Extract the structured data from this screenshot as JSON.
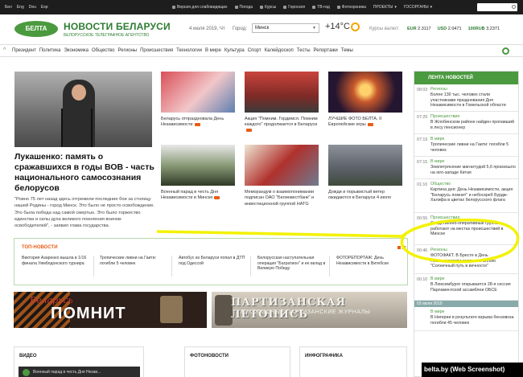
{
  "topbar": {
    "langs": [
      "Бел",
      "Eng",
      "Deu",
      "Esp"
    ],
    "links": [
      "Версия для слабовидящих",
      "Погода",
      "Курсы",
      "Гороскоп",
      "ТВ-гид",
      "Фотохроника",
      "ПРОЕКТЫ",
      "ГОСОРГАНЫ"
    ]
  },
  "header": {
    "logo": "БЕЛТА",
    "title": "НОВОСТИ БЕЛАРУСИ",
    "subtitle": "БЕЛОРУССКОЕ ТЕЛЕГРАФНОЕ АГЕНТСТВО",
    "date": "4 июля 2019, Чт",
    "city_label": "Город:",
    "city": "Минск",
    "temperature": "+14°C",
    "rates_label": "Курсы валют:",
    "rates": [
      {
        "code": "EUR",
        "value": "2.3117"
      },
      {
        "code": "USD",
        "value": "2.0471"
      },
      {
        "code": "100RUB",
        "value": "3.2371"
      }
    ]
  },
  "nav": {
    "items": [
      "Президент",
      "Политика",
      "Экономика",
      "Общество",
      "Регионы",
      "Происшествия",
      "Технологии",
      "В мире",
      "Культура",
      "Спорт",
      "Калейдоскоп",
      "Тесты",
      "Репортажи",
      "Темы"
    ]
  },
  "lead": {
    "title": "Лукашенко: память о сражавшихся в годы ВОВ - часть национального самосознания белорусов",
    "text": "\"Ровно 75 лет назад здесь отгремели последние бои за столицу нашей Родины - город Минск. Это было не просто освобождение. Это была победа над самой смертью. Это было торжество единства и силы духа великого поколения воинов-освободителей\", - заявил глава государства."
  },
  "thumbs": [
    {
      "caption": "Беларусь отпраздновала День Независимости"
    },
    {
      "caption": "Акция \"Помним. Гордимся. Помним каждого\" продолжается в Беларуси"
    },
    {
      "caption": "ЛУЧШИЕ ФОТО БЕЛТА. II Европейские игры"
    },
    {
      "caption": "Военный парад в честь Дня Независимости в Минске"
    },
    {
      "caption": "Меморандум о взаимопонимании подписан ОАО \"Белинвестбанк\" и инвестиционной группой HATG"
    },
    {
      "caption": "Дожди и порывистый ветер ожидаются в Беларуси 4 июля"
    }
  ],
  "feed": {
    "title": "ЛЕНТА НОВОСТЕЙ",
    "items": [
      {
        "time": "08:03",
        "cat": "Регионы",
        "text": "Более 130 тыс. человек стали участниками празднования Дня Независимости в Гомельской области"
      },
      {
        "time": "07:29",
        "cat": "Происшествия",
        "text": "В Жлобинском районе найден пропавший в лесу пенсионер"
      },
      {
        "time": "07:19",
        "cat": "В мире",
        "text": "Тропические ливни на Гаити: погибли 5 человек"
      },
      {
        "time": "07:15",
        "cat": "В мире",
        "text": "Землетрясение магнитудой 5,6 произошло на юго-западе Китая"
      },
      {
        "time": "01:10",
        "cat": "Общество",
        "text": "Картина дня: День Независимости, акция \"Беларусь помнит\" и небоскреб Бурдж-Халифа в цветах белорусского флага"
      },
      {
        "time": "00:55",
        "cat": "Происшествия",
        "text": "Следственно-оперативные группы работают на местах происшествий в Минске"
      },
      {
        "time": "00:46",
        "cat": "Регионы",
        "text": "ФОТОФАКТ. В Бресте в День Независимости заложили аллею \"Солнечный путь в вечности\""
      },
      {
        "time": "00:10",
        "cat": "В мире",
        "text": "В Люксембурге открывается 28-я сессия Парламентской ассамблеи ОБСЕ"
      },
      {
        "time": "",
        "cat": "В мире",
        "text": "В Нигерии в результате взрыва бензовоза погибли 45 человек"
      }
    ],
    "date_separator": "03 июля 2019"
  },
  "top_news": {
    "title": "ТОП-НОВОСТИ",
    "items": [
      "Виктория Азаренко вышла в 1/16 финала Уимблдонского турнира",
      "Тропические ливни на Гаити: погибли 5 человек",
      "Автобус из Беларуси попал в ДТП под Одессой",
      "Белорусская наступательная операция \"Багратион\" и ее вклад в Великую Победу",
      "ФОТОРЕПОРТАЖ: День Независимости в Витебске"
    ]
  },
  "banners": {
    "left_small": "Беларусь",
    "left_big": "ПОМНИТ",
    "right_big": "ПАРТИЗАНСКАЯ ЛЕТОПИСЬ",
    "right_small": "РУКОПИСНЫЕ ПАРТИЗАНСКИЕ ЖУРНАЛЫ"
  },
  "sections": [
    "ВИДЕО",
    "ФОТОНОВОСТИ",
    "ИНФОГРАФИКА"
  ],
  "video_caption": "Военный парад в честь Дня Незав...",
  "credit": "belta.by (Web Screenshot)",
  "colors": {
    "brand_green": "#4b9a3f",
    "accent_orange": "#e85d16",
    "highlight": "#f2f200"
  }
}
